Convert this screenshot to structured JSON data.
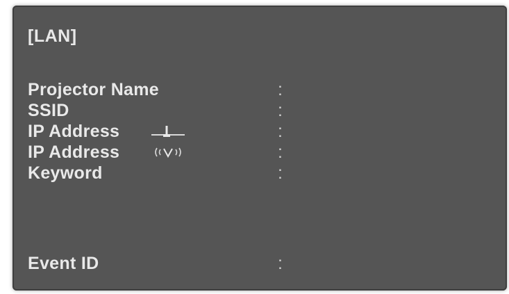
{
  "lan": {
    "title": "[LAN]",
    "fields": {
      "projector_name": {
        "label": "Projector Name",
        "separator": ":"
      },
      "ssid": {
        "label": "SSID",
        "separator": ":"
      },
      "ip_address_wired": {
        "label": "IP Address",
        "separator": ":",
        "icon": "wired-lan-icon"
      },
      "ip_address_wireless": {
        "label": "IP Address",
        "separator": ":",
        "icon": "wireless-lan-icon"
      },
      "keyword": {
        "label": "Keyword",
        "separator": ":"
      },
      "event_id": {
        "label": "Event ID",
        "separator": ":"
      }
    }
  },
  "colors": {
    "panel_background": "#555555",
    "text": "#e9e9e9"
  }
}
